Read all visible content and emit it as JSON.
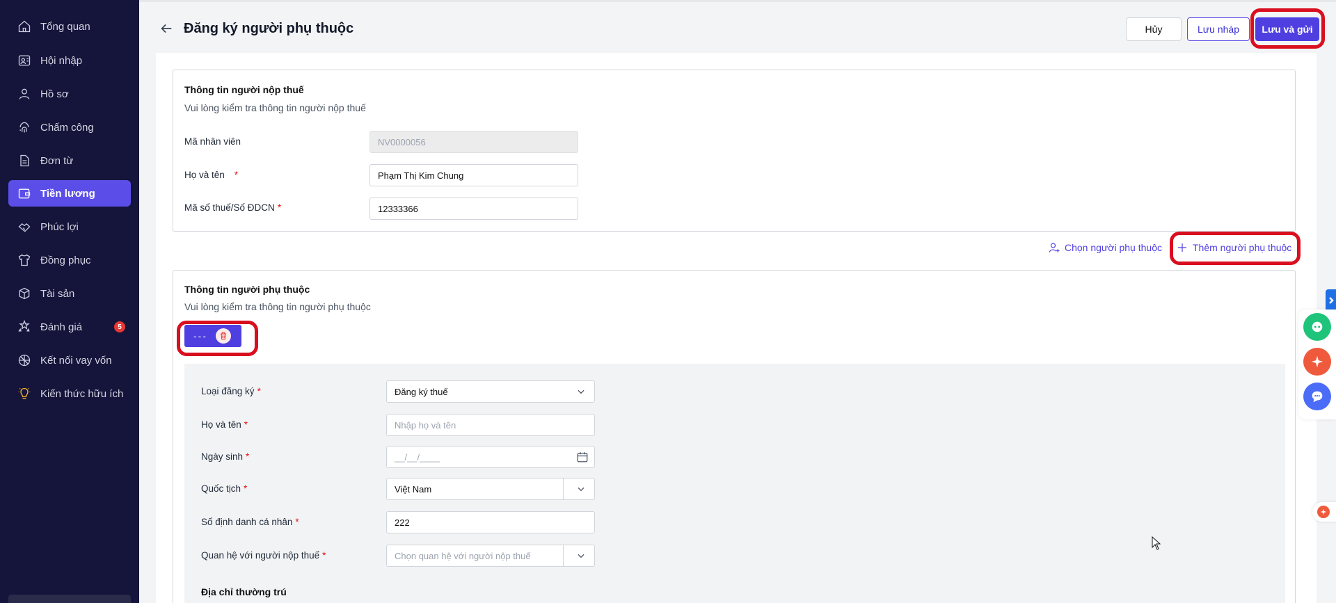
{
  "sidebar": {
    "items": [
      {
        "label": "Tổng quan",
        "icon": "home-icon"
      },
      {
        "label": "Hội nhập",
        "icon": "onboarding-icon"
      },
      {
        "label": "Hồ sơ",
        "icon": "user-icon"
      },
      {
        "label": "Chấm công",
        "icon": "fingerprint-icon"
      },
      {
        "label": "Đơn từ",
        "icon": "document-icon"
      },
      {
        "label": "Tiền lương",
        "icon": "wallet-icon"
      },
      {
        "label": "Phúc lợi",
        "icon": "handshake-icon"
      },
      {
        "label": "Đồng phục",
        "icon": "shirt-icon"
      },
      {
        "label": "Tài sản",
        "icon": "box-icon"
      },
      {
        "label": "Đánh giá",
        "icon": "stars-icon",
        "badge": "5"
      },
      {
        "label": "Kết nối vay vốn",
        "icon": "network-icon"
      },
      {
        "label": "Kiến thức hữu ích",
        "icon": "bulb-icon"
      }
    ],
    "active_index": 5
  },
  "header": {
    "title": "Đăng ký người phụ thuộc",
    "cancel_label": "Hủy",
    "draft_label": "Lưu nháp",
    "save_label": "Lưu và gửi"
  },
  "taxpayer": {
    "title": "Thông tin người nộp thuế",
    "subtitle": "Vui lòng kiểm tra thông tin người nộp thuế",
    "employee_code_label": "Mã nhân viên",
    "employee_code_value": "NV0000056",
    "fullname_label": "Họ và tên",
    "fullname_value": "Phạm Thị Kim Chung",
    "taxcode_label": "Mã số thuế/Số ĐDCN",
    "taxcode_value": "12333366"
  },
  "actions": {
    "choose_dependent": "Chọn người phụ thuộc",
    "add_dependent": "Thêm người phụ thuộc"
  },
  "dependent": {
    "title": "Thông tin người phụ thuộc",
    "subtitle": "Vui lòng kiểm tra thông tin người phụ thuộc",
    "tab_label": "---",
    "reg_type_label": "Loại đăng ký",
    "reg_type_value": "Đăng ký thuế",
    "name_label": "Họ và tên",
    "name_placeholder": "Nhập họ và tên",
    "dob_label": "Ngày sinh",
    "dob_placeholder": "__/__/____",
    "nationality_label": "Quốc tịch",
    "nationality_value": "Việt Nam",
    "id_label": "Số định danh cá nhân",
    "id_value": "222",
    "relation_label": "Quan hệ với người nộp thuế",
    "relation_placeholder": "Chọn quan hệ với người nộp thuế",
    "address_heading": "Địa chỉ thường trú"
  },
  "colors": {
    "sidebar_bg": "#15143a",
    "accent": "#4f3fe0",
    "highlight": "#d90f1f"
  }
}
